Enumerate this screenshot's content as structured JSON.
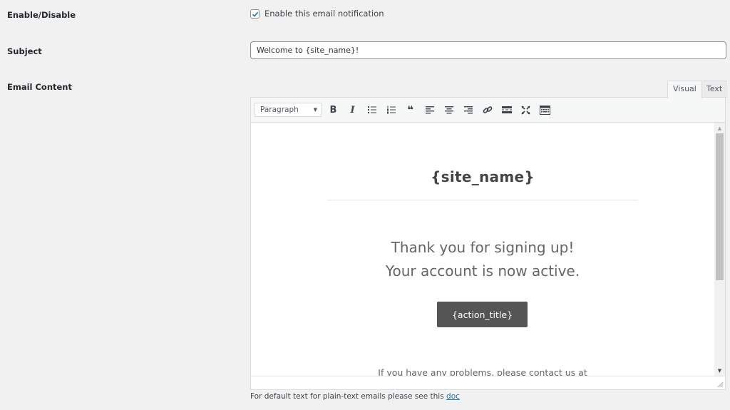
{
  "rows": {
    "enable_label": "Enable/Disable",
    "subject_label": "Subject",
    "content_label": "Email Content"
  },
  "enable": {
    "checked": true,
    "checkbox_label": "Enable this email notification"
  },
  "subject": {
    "value": "Welcome to {site_name}!"
  },
  "editor": {
    "tabs": [
      {
        "label": "Visual",
        "active": true
      },
      {
        "label": "Text",
        "active": false
      }
    ],
    "toolbar": {
      "format_select": "Paragraph",
      "buttons": [
        {
          "icon": "bold-icon",
          "glyph": "B"
        },
        {
          "icon": "italic-icon",
          "glyph": "I"
        },
        {
          "icon": "bulleted-list-icon"
        },
        {
          "icon": "numbered-list-icon"
        },
        {
          "icon": "blockquote-icon",
          "glyph": "❝"
        },
        {
          "icon": "align-left-icon"
        },
        {
          "icon": "align-center-icon"
        },
        {
          "icon": "align-right-icon"
        },
        {
          "icon": "link-icon"
        },
        {
          "icon": "read-more-icon"
        },
        {
          "icon": "fullscreen-icon"
        },
        {
          "icon": "toolbar-toggle-icon"
        }
      ]
    },
    "content": {
      "site_name": "{site_name}",
      "line1": "Thank you for signing up!",
      "line2": "Your account is now active.",
      "action_button": "{action_title}",
      "problems_line": "If you have any problems, please contact us at"
    },
    "scroll_position": 0
  },
  "footnote": {
    "text": "For default text for plain-text emails please see this ",
    "link_label": "doc"
  },
  "colors": {
    "page_bg": "#f1f1f1",
    "checkbox_check": "#2271b1",
    "action_button_bg": "#555555",
    "link": "#2271b1"
  }
}
